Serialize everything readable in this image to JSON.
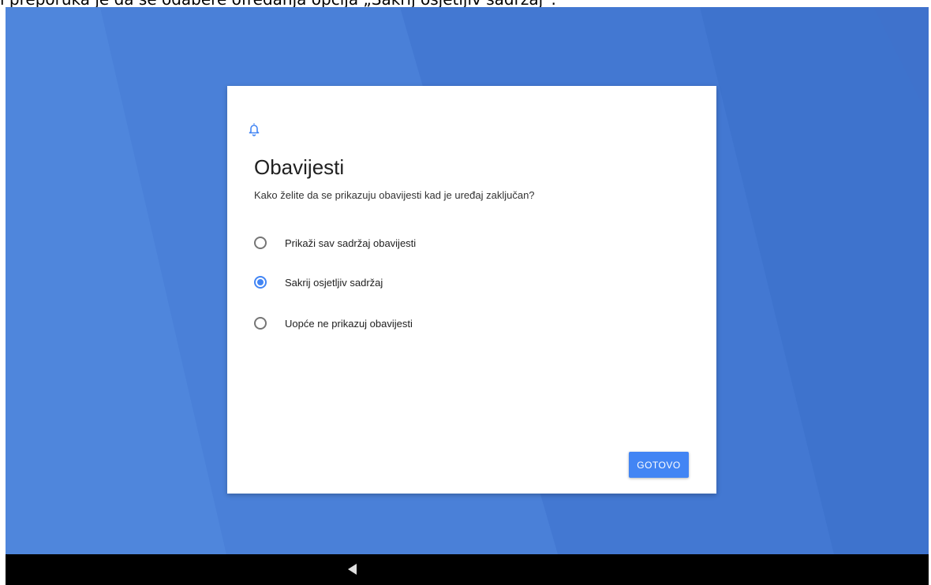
{
  "caption": "i preporuka je da se odabere ofredanja opcija „Sakrij osjetljiv sadržaj“.",
  "dialog": {
    "icon": "bell-icon",
    "title": "Obavijesti",
    "subtitle": "Kako želite da se prikazuju obavijesti kad je uređaj zaključan?",
    "options": [
      {
        "label": "Prikaži sav sadržaj obavijesti",
        "selected": false
      },
      {
        "label": "Sakrij osjetljiv sadržaj",
        "selected": true
      },
      {
        "label": "Uopće ne prikazuj obavijesti",
        "selected": false
      }
    ],
    "done_label": "GOTOVO"
  },
  "navbar": {
    "back_icon": "back-triangle-icon"
  },
  "colors": {
    "accent": "#4285f4",
    "wallpaper": "#4a7fd6",
    "navbar": "#000000"
  }
}
